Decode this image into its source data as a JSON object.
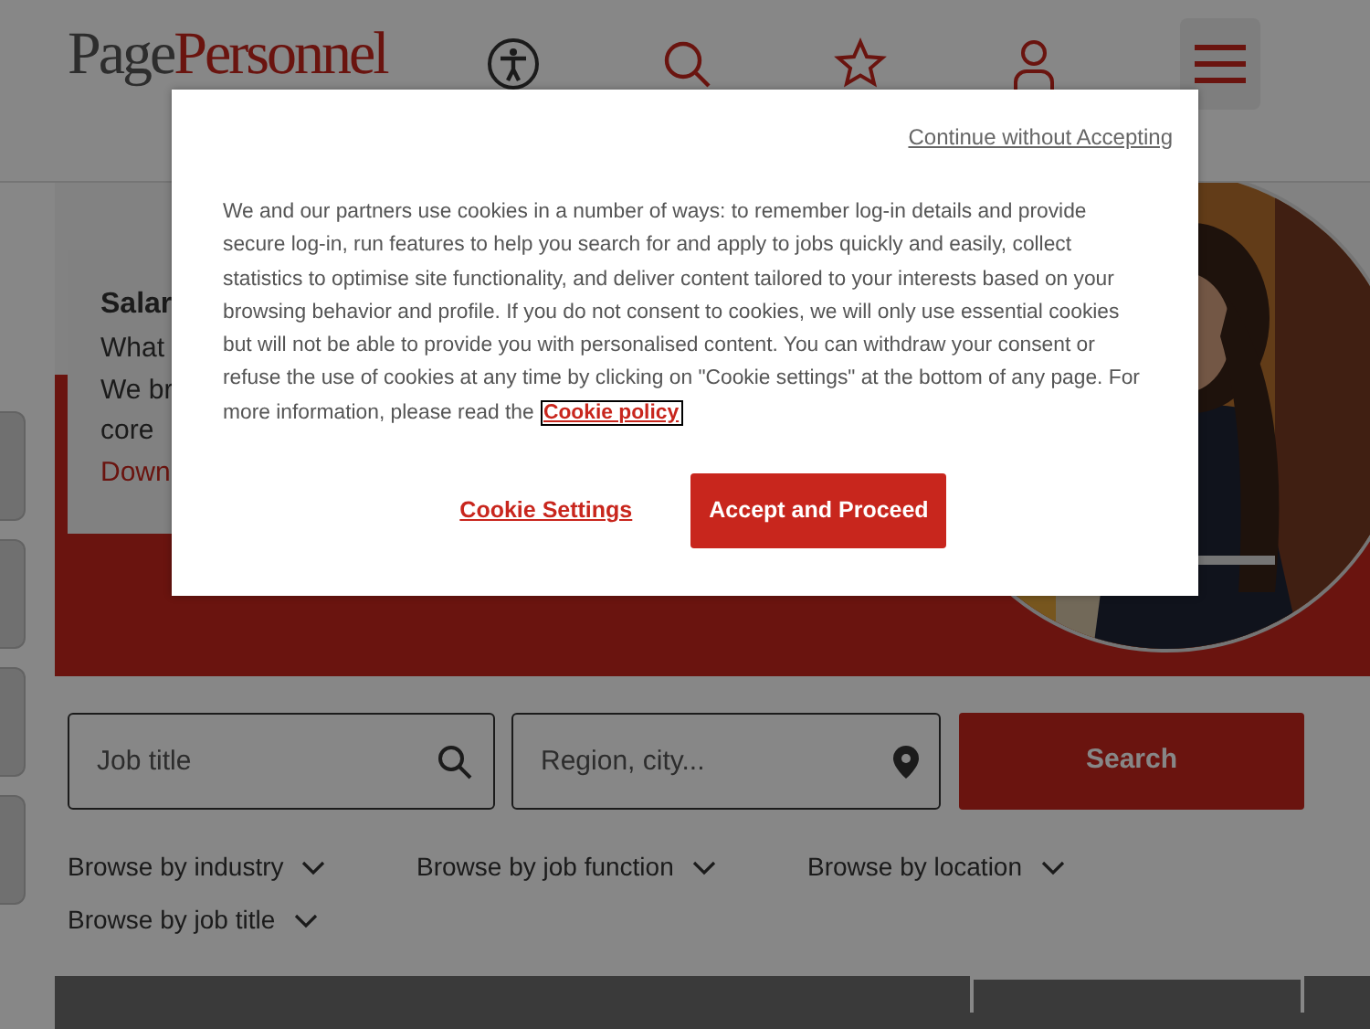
{
  "header": {
    "logo_first": "Page",
    "logo_second": "Personnel"
  },
  "hero": {
    "card_title": "Salar",
    "card_lines": [
      "What",
      "We br",
      "core"
    ],
    "card_link": "Down",
    "photo": {
      "kind": "picture"
    }
  },
  "search": {
    "job_placeholder": "Job title",
    "location_placeholder": "Region, city...",
    "button": "Search"
  },
  "browse_links": [
    "Browse by industry",
    "Browse by job function",
    "Browse by location",
    "Browse by job title"
  ],
  "cookie_dialog": {
    "dismiss_link": "Continue without Accepting",
    "body": "We and our partners use cookies in a number of ways: to remember log-in details and provide secure log-in, run features to help you search for and apply to jobs quickly and easily, collect statistics to optimise site functionality, and deliver content tailored to your interests based on your browsing behavior and profile. If you do not consent to cookies, we will only use essential cookies but will not be able to provide you with personalised content. You can withdraw your consent or refuse the use of cookies at any time by clicking on \"Cookie settings\" at the bottom of any page. For more information, please read the",
    "policy_link": "Cookie policy",
    "buttons": [
      {
        "label": "Cookie Settings",
        "kind": "link"
      },
      {
        "label": "Accept and Proceed",
        "kind": "primary"
      }
    ]
  }
}
